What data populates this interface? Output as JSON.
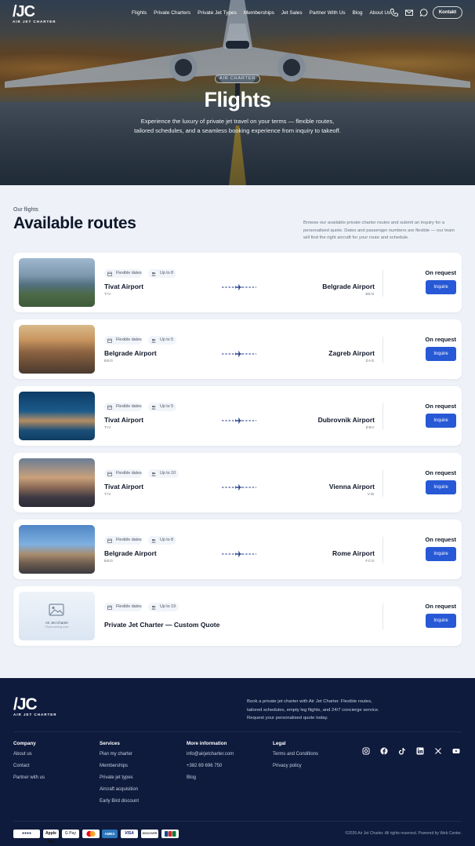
{
  "nav": {
    "logo_mark": "/JC",
    "logo_sub": "AIR JET CHARTER",
    "links": [
      "Flights",
      "Private Charters",
      "Private Jet Types",
      "Memberships",
      "Jet Sales",
      "Partner With Us",
      "Blog",
      "About Us"
    ],
    "cta": "Kontakt"
  },
  "hero": {
    "badge": "AIR CHARTER",
    "title": "Flights",
    "subtitle": "Experience the luxury of private jet travel on your terms — flexible routes, tailored schedules, and a seamless booking experience from inquiry to takeoff."
  },
  "section": {
    "eyebrow": "Our flights",
    "title": "Available routes",
    "description": "Browse our available private charter routes and submit an inquiry for a personalised quote. Dates and passenger numbers are flexible — our team will find the right aircraft for your route and schedule."
  },
  "routes": [
    {
      "dates": "Flexible dates",
      "pax": "Up to 8",
      "from": "Tivat Airport",
      "from_code": "TIV",
      "to": "Belgrade Airport",
      "to_code": "BEG",
      "price": "On request",
      "button": "Inquire"
    },
    {
      "dates": "Flexible dates",
      "pax": "Up to 5",
      "from": "Belgrade Airport",
      "from_code": "BEG",
      "to": "Zagreb Airport",
      "to_code": "ZAG",
      "price": "On request",
      "button": "Inquire"
    },
    {
      "dates": "Flexible dates",
      "pax": "Up to 5",
      "from": "Tivat Airport",
      "from_code": "TIV",
      "to": "Dubrovnik Airport",
      "to_code": "DBV",
      "price": "On request",
      "button": "Inquire"
    },
    {
      "dates": "Flexible dates",
      "pax": "Up to 10",
      "from": "Tivat Airport",
      "from_code": "TIV",
      "to": "Vienna Airport",
      "to_code": "VIE",
      "price": "On request",
      "button": "Inquire"
    },
    {
      "dates": "Flexible dates",
      "pax": "Up to 8",
      "from": "Belgrade Airport",
      "from_code": "BEG",
      "to": "Rome Airport",
      "to_code": "FCO",
      "price": "On request",
      "button": "Inquire"
    },
    {
      "dates": "Flexible dates",
      "pax": "Up to 19",
      "title": "Private Jet Charter — Custom Quote",
      "placeholder_title": "Air Jet Charter",
      "placeholder_sub": "Photo coming soon",
      "price": "On request",
      "button": "Inquire"
    }
  ],
  "footer": {
    "logo_mark": "/JC",
    "logo_sub": "AIR JET CHARTER",
    "about": "Book a private jet charter with Air Jet Charter. Flexible routes, tailored schedules, empty leg flights, and 24/7 concierge service. Request your personalised quote today.",
    "columns": [
      {
        "title": "Company",
        "items": [
          "About us",
          "Contact",
          "Partner with us"
        ]
      },
      {
        "title": "Services",
        "items": [
          "Plan my charter",
          "Memberships",
          "Private jet types",
          "Aircraft acquisition",
          "Early Bird discount"
        ]
      },
      {
        "title": "More information",
        "items": [
          "info@airjetcharter.com",
          "+382 69 696 750",
          "Blog"
        ]
      },
      {
        "title": "Legal",
        "items": [
          "Terms and Conditions",
          "Privacy policy"
        ]
      }
    ],
    "payments": [
      "Apple Pay",
      "G Pay",
      "AMEX",
      "VISA",
      "DISCOVER"
    ],
    "copyright": "©2026 Air Jet Charter. All rights reserved. Powered by Web Center."
  }
}
